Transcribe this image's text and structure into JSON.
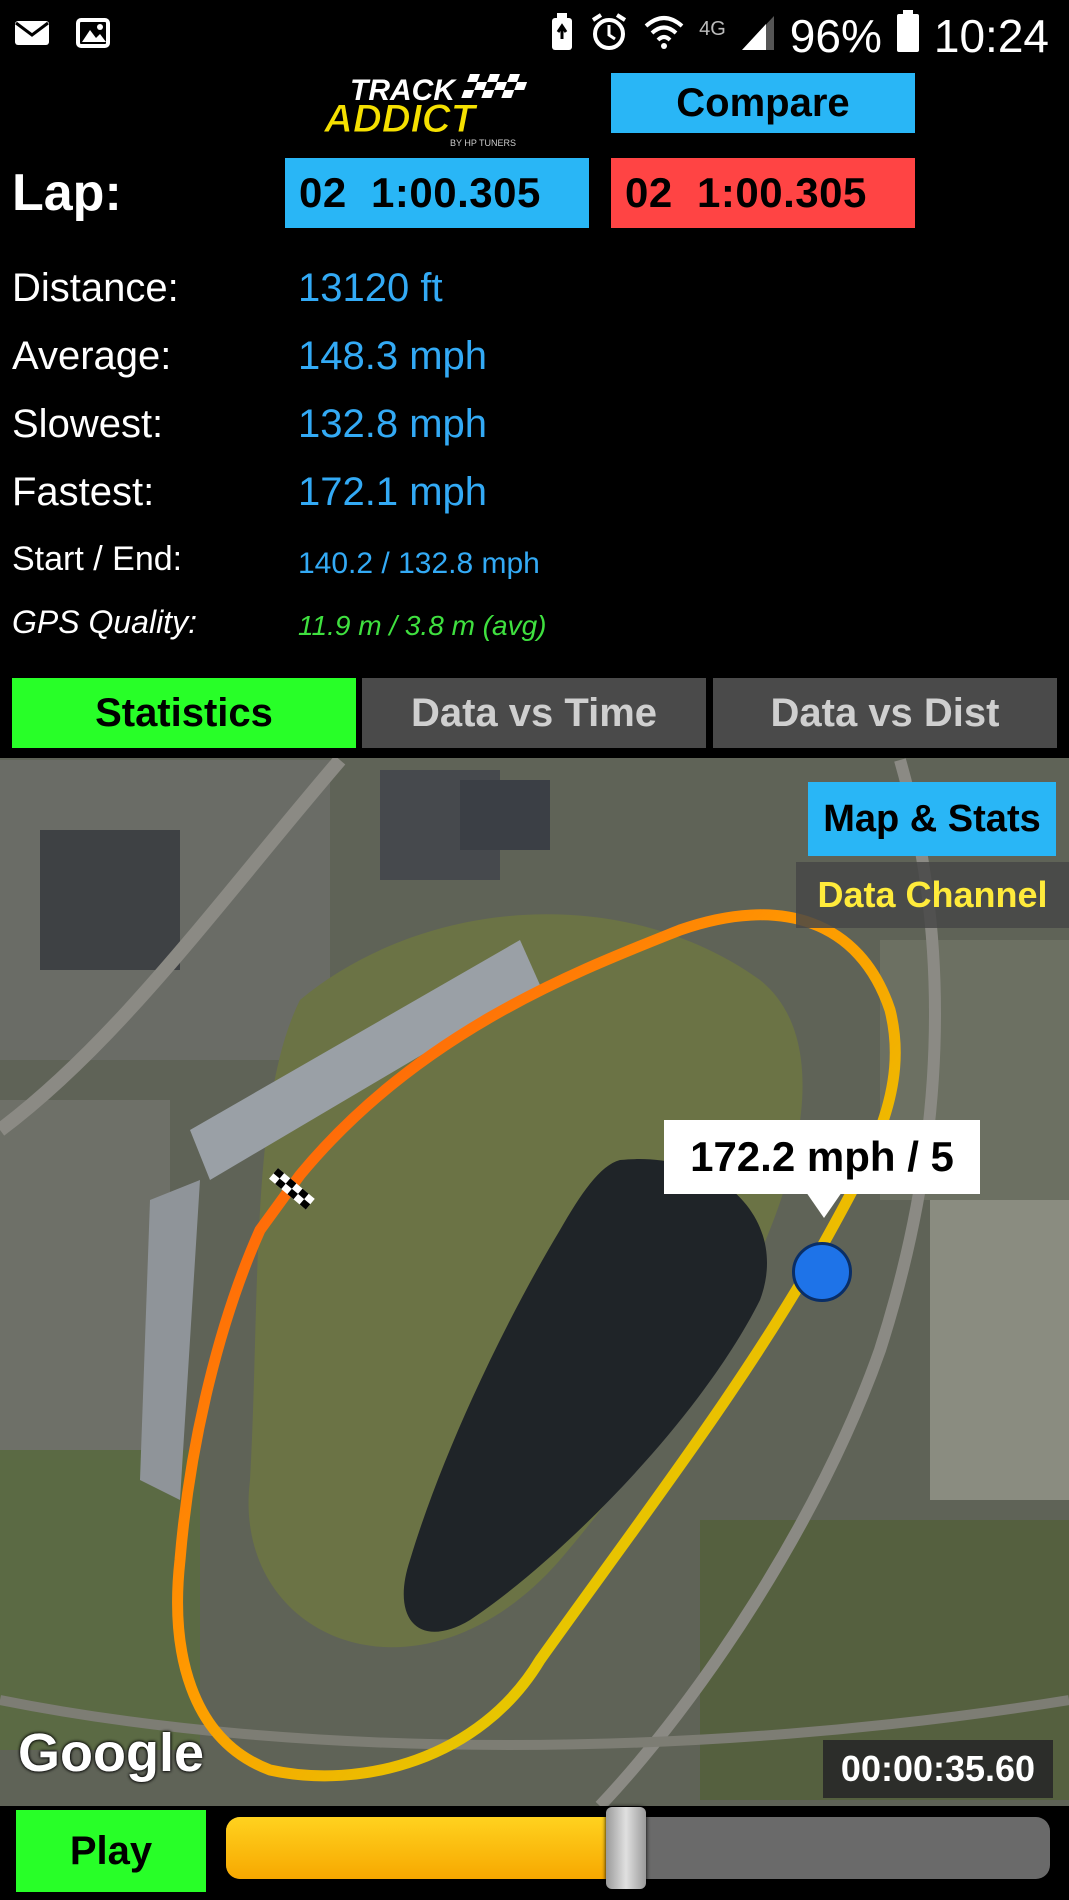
{
  "status_bar": {
    "left_icons": [
      "mail-icon",
      "image-icon"
    ],
    "right_icons": [
      "battery-saver-icon",
      "alarm-icon",
      "wifi-icon",
      "4g-icon",
      "signal-icon",
      "battery-icon"
    ],
    "battery_pct": "96%",
    "time": "10:24"
  },
  "header": {
    "logo_text_top": "TRACK",
    "logo_text_main": "ADDICT",
    "logo_subtext": "BY HP TUNERS",
    "compare_label": "Compare",
    "lap_label": "Lap:",
    "lap_a": "02  1:00.305",
    "lap_b": "02  1:00.305"
  },
  "stats": {
    "distance_label": "Distance:",
    "distance_value": "13120 ft",
    "average_label": "Average:",
    "average_value": "148.3 mph",
    "slowest_label": "Slowest:",
    "slowest_value": "132.8 mph",
    "fastest_label": "Fastest:",
    "fastest_value": "172.1 mph",
    "startend_label": "Start / End:",
    "startend_value": "140.2 / 132.8 mph",
    "gps_label": "GPS Quality:",
    "gps_value": "11.9 m / 3.8 m (avg)"
  },
  "tabs": [
    {
      "label": "Statistics",
      "active": true
    },
    {
      "label": "Data vs Time",
      "active": false
    },
    {
      "label": "Data vs Dist",
      "active": false
    }
  ],
  "map": {
    "map_stats_label": "Map & Stats",
    "data_channel_label": "Data Channel",
    "tooltip": "172.2 mph / 5",
    "google_logo": "Google",
    "timer": "00:00:35.60"
  },
  "controls": {
    "play_label": "Play",
    "progress_fraction": 0.485
  },
  "colors": {
    "accent_blue": "#29b6f6",
    "accent_red": "#ff4444",
    "accent_green": "#28ff28",
    "value_blue": "#33aaf5",
    "gps_green": "#3fe03f",
    "data_channel_yellow": "#ffeb3b"
  }
}
